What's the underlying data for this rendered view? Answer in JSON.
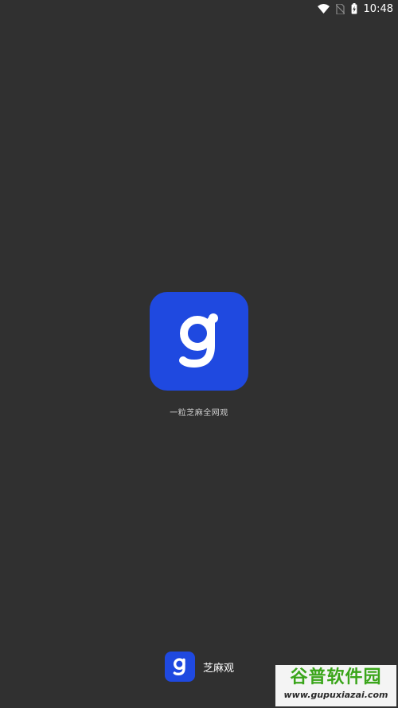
{
  "status_bar": {
    "time": "10:48",
    "icons": [
      "wifi-icon",
      "no-sim-icon",
      "battery-charging-icon"
    ]
  },
  "splash": {
    "logo_icon": "app-logo-g-icon",
    "tagline": "一粒芝麻全网观",
    "accent_color": "#1f49e0",
    "background_color": "#303030"
  },
  "footer": {
    "logo_icon": "app-logo-g-small-icon",
    "app_name": "芝麻观"
  },
  "watermark": {
    "title": "谷普软件园",
    "url": "www.gupuxiazai.com"
  }
}
